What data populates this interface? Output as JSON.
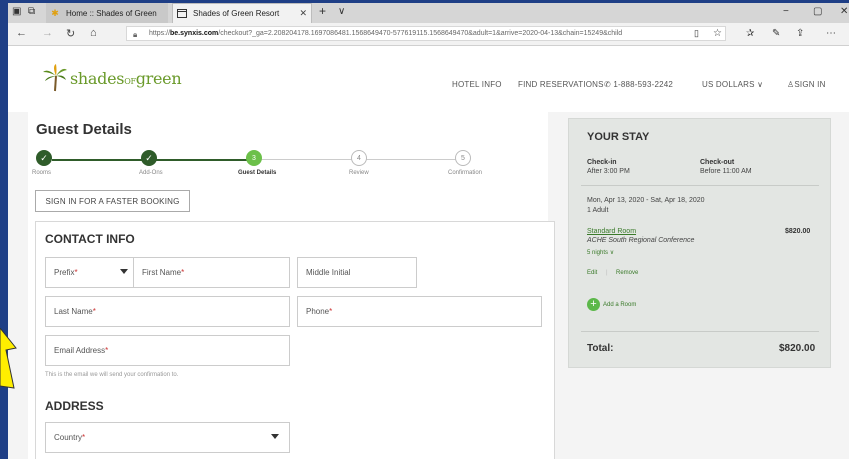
{
  "browser": {
    "tabs": [
      {
        "title": "Home :: Shades of Green",
        "active": false
      },
      {
        "title": "Shades of Green Resort",
        "active": true
      }
    ],
    "new_tab": "+",
    "tab_menu": "∨",
    "window_controls": [
      "−",
      "▢",
      "✕"
    ],
    "url_domain": "be.synxis.com",
    "url_prefix": "https://",
    "url_rest": "/checkout?_ga=2.208204178.1697086481.1568649470-577619115.1568649470&adult=1&arrive=2020-04-13&chain=15249&child"
  },
  "site": {
    "logo_main": "shades",
    "logo_of": "OF",
    "logo_green": "green",
    "nav": {
      "hotel_info": "HOTEL INFO",
      "find_reservations": "FIND RESERVATIONS",
      "phone": "1-888-593-2242",
      "currency": "US DOLLARS",
      "sign_in": "SIGN IN"
    }
  },
  "checkout": {
    "title": "Guest Details",
    "steps": [
      {
        "label": "Rooms",
        "num": "✓",
        "state": "done"
      },
      {
        "label": "Add-Ons",
        "num": "✓",
        "state": "done"
      },
      {
        "label": "Guest Details",
        "num": "3",
        "state": "current"
      },
      {
        "label": "Review",
        "num": "4",
        "state": "todo"
      },
      {
        "label": "Confirmation",
        "num": "5",
        "state": "todo"
      }
    ],
    "signin_button": "SIGN IN FOR A FASTER BOOKING",
    "contact_title": "CONTACT INFO",
    "fields": {
      "prefix": "Prefix",
      "first_name": "First Name",
      "middle_initial": "Middle Initial",
      "last_name": "Last Name",
      "phone": "Phone",
      "email": "Email Address",
      "country": "Country"
    },
    "required_mark": "*",
    "email_hint": "This is the email we will send your confirmation to.",
    "address_title": "ADDRESS"
  },
  "stay": {
    "title": "YOUR STAY",
    "checkin_label": "Check-in",
    "checkin_value": "After 3:00 PM",
    "checkout_label": "Check-out",
    "checkout_value": "Before 11:00 AM",
    "dates": "Mon, Apr 13, 2020 - Sat, Apr 18, 2020",
    "guests": "1 Adult",
    "room_name": "Standard Room",
    "room_price": "$820.00",
    "rate_name": "ACHE South Regional Conference",
    "nights": "5 nights",
    "edit": "Edit",
    "remove": "Remove",
    "add_room": "Add a Room",
    "total_label": "Total:",
    "total_value": "$820.00"
  },
  "colors": {
    "frame": "#1f3f86",
    "accent_green": "#6cc04a",
    "dark_green": "#2f5c2a",
    "annotation_arrow": "#ffee00"
  }
}
